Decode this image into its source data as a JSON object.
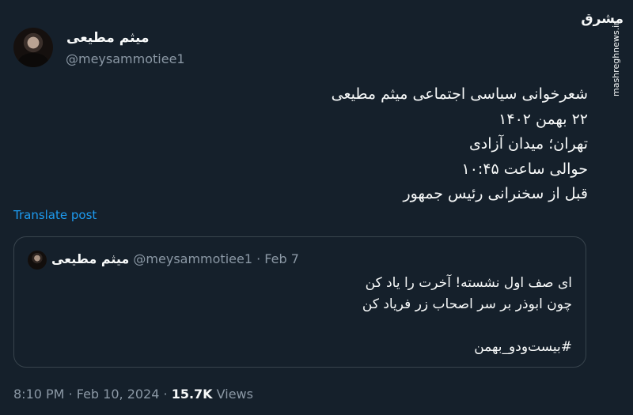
{
  "author": {
    "name": "میثم مطیعی",
    "handle": "@meysammotiee1"
  },
  "tweet": {
    "lines": [
      "شعرخوانی سیاسی اجتماعی میثم مطیعی",
      "۲۲ بهمن ۱۴۰۲",
      "تهران؛ میدان آزادی",
      "حوالی ساعت ۱۰:۴۵",
      "قبل از سخنرانی رئیس جمهور"
    ],
    "translate_label": "Translate post"
  },
  "quote": {
    "name": "میثم مطیعی",
    "handle": "@meysammotiee1",
    "separator": "·",
    "date": "Feb 7",
    "lines": [
      "ای صف اول نشسته! آخرت را یاد کن",
      "چون ابوذر بر سر اصحاب زر فریاد کن",
      "",
      "#بیست‌ودو_بهمن"
    ]
  },
  "meta": {
    "time": "8:10 PM",
    "sep1": "·",
    "date": "Feb 10, 2024",
    "sep2": "·",
    "views_count": "15.7K",
    "views_label": "Views"
  },
  "watermark": {
    "logo_text": "مشرق",
    "url": "mashreghnews.ir"
  }
}
